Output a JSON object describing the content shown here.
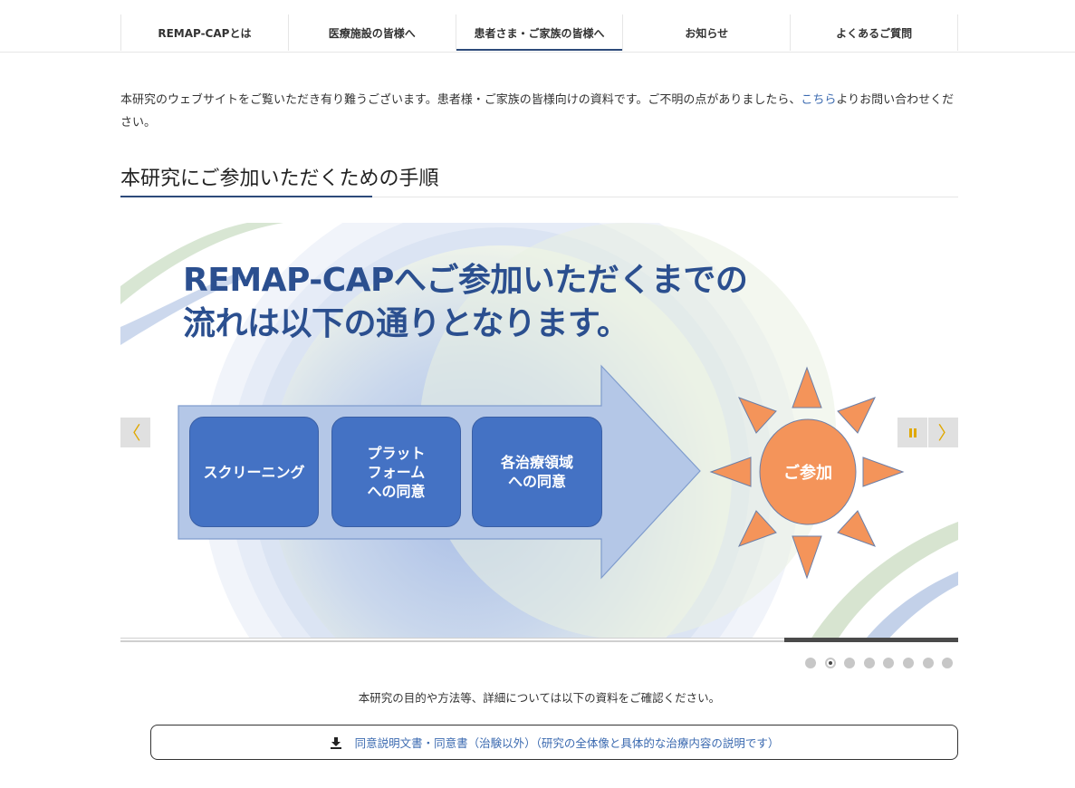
{
  "nav": {
    "items": [
      {
        "label": "REMAP-CAPとは",
        "active": false
      },
      {
        "label": "医療施設の皆様へ",
        "active": false
      },
      {
        "label": "患者さま・ご家族の皆様へ",
        "active": true
      },
      {
        "label": "お知らせ",
        "active": false
      },
      {
        "label": "よくあるご質問",
        "active": false
      }
    ]
  },
  "intro": {
    "text_before": "本研究のウェブサイトをご覧いただき有り難うございます。患者様・ご家族の皆様向けの資料です。ご不明の点がありましたら、",
    "link": "こちら",
    "text_after": "よりお問い合わせください。"
  },
  "section": {
    "title": "本研究にご参加いただくための手順"
  },
  "slide": {
    "title_line1": "REMAP-CAPへご参加いただくまでの",
    "title_line2": "流れは以下の通りとなります。",
    "steps": [
      "スクリーニング",
      "プラット\nフォーム\nへの同意",
      "各治療領域\nへの同意"
    ],
    "final": "ご参加"
  },
  "slider_controls": {
    "prev_glyph": "〈",
    "next_glyph": "〉",
    "pause_glyph": "⏸",
    "dot_count": 8,
    "active_dot_index": 1
  },
  "colors": {
    "accent": "#2d4a7a",
    "link": "#3b6ab0",
    "step_box": "#4472c4",
    "sun": "#f4945a",
    "title": "#2b4f8f"
  },
  "note": "本研究の目的や方法等、詳細については以下の資料をご確認ください。",
  "document_button": {
    "label": "同意説明文書・同意書（治験以外）（研究の全体像と具体的な治療内容の説明です）",
    "icon": "download-icon"
  }
}
